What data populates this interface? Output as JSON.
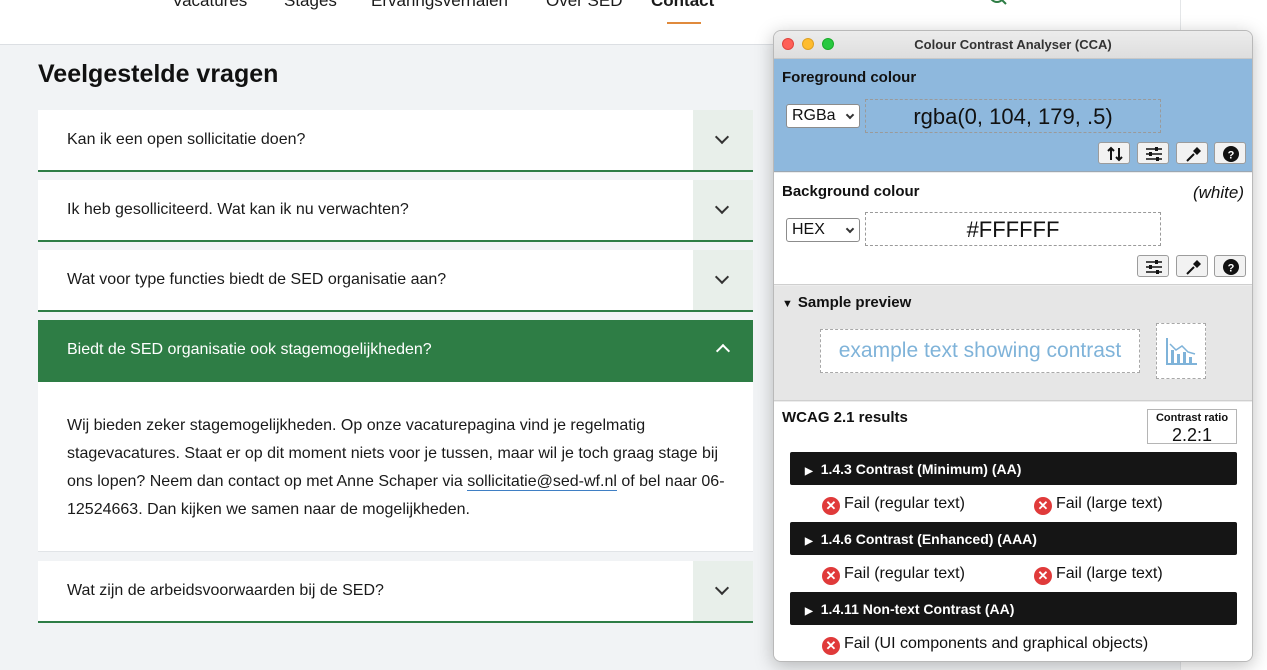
{
  "site": {
    "nav": [
      {
        "label": "Vacatures"
      },
      {
        "label": "Stages"
      },
      {
        "label": "Ervaringsverhalen"
      },
      {
        "label": "Over SED"
      },
      {
        "label": "Contact",
        "active": true
      }
    ],
    "faq_title": "Veelgestelde vragen",
    "faq": [
      {
        "question": "Kan ik een open sollicitatie doen?"
      },
      {
        "question": "Ik heb gesolliciteerd. Wat kan ik nu verwachten?"
      },
      {
        "question": "Wat voor type functies biedt de SED organisatie aan?"
      },
      {
        "question": "Biedt de SED organisatie ook stagemogelijkheden?",
        "expanded": true
      },
      {
        "question": "Wat zijn de arbeidsvoorwaarden bij de SED?"
      }
    ],
    "answer": {
      "before_link": "Wij bieden zeker stagemogelijkheden. Op onze vacaturepagina vind je regelmatig stagevacatures. Staat er op dit moment niets voor je tussen, maar wil je toch graag stage bij ons lopen? Neem dan contact op met Anne Schaper via ",
      "link": "sollicitatie@sed-wf.nl",
      "after_link": " of bel naar 06-12524663. Dan kijken we samen naar de mogelijkheden."
    },
    "colors": {
      "accent_green": "#2e7d45",
      "nav_underline": "#e08a3c"
    }
  },
  "cca": {
    "window_title": "Colour Contrast Analyser (CCA)",
    "foreground": {
      "label": "Foreground colour",
      "format": "RGBa",
      "value": "rgba(0, 104, 179, .5)",
      "panel_color": "#8eb8dd"
    },
    "background": {
      "label": "Background colour",
      "name": "(white)",
      "format": "HEX",
      "value": "#FFFFFF"
    },
    "icons": {
      "swap": "swap-icon",
      "sliders": "sliders-icon",
      "eyedropper": "eyedropper-icon",
      "help": "help-icon"
    },
    "preview": {
      "label": "Sample preview",
      "sample_text": "example text showing contrast",
      "sample_icon": "chart-icon"
    },
    "results": {
      "label": "WCAG 2.1 results",
      "ratio_label": "Contrast ratio",
      "ratio_value": "2.2:1",
      "criteria": [
        {
          "title": "1.4.3 Contrast (Minimum) (AA)",
          "results": [
            "Fail (regular text)",
            "Fail (large text)"
          ]
        },
        {
          "title": "1.4.6 Contrast (Enhanced) (AAA)",
          "results": [
            "Fail (regular text)",
            "Fail (large text)"
          ]
        },
        {
          "title": "1.4.11 Non-text Contrast (AA)",
          "results": [
            "Fail (UI components and graphical objects)"
          ]
        }
      ]
    }
  }
}
